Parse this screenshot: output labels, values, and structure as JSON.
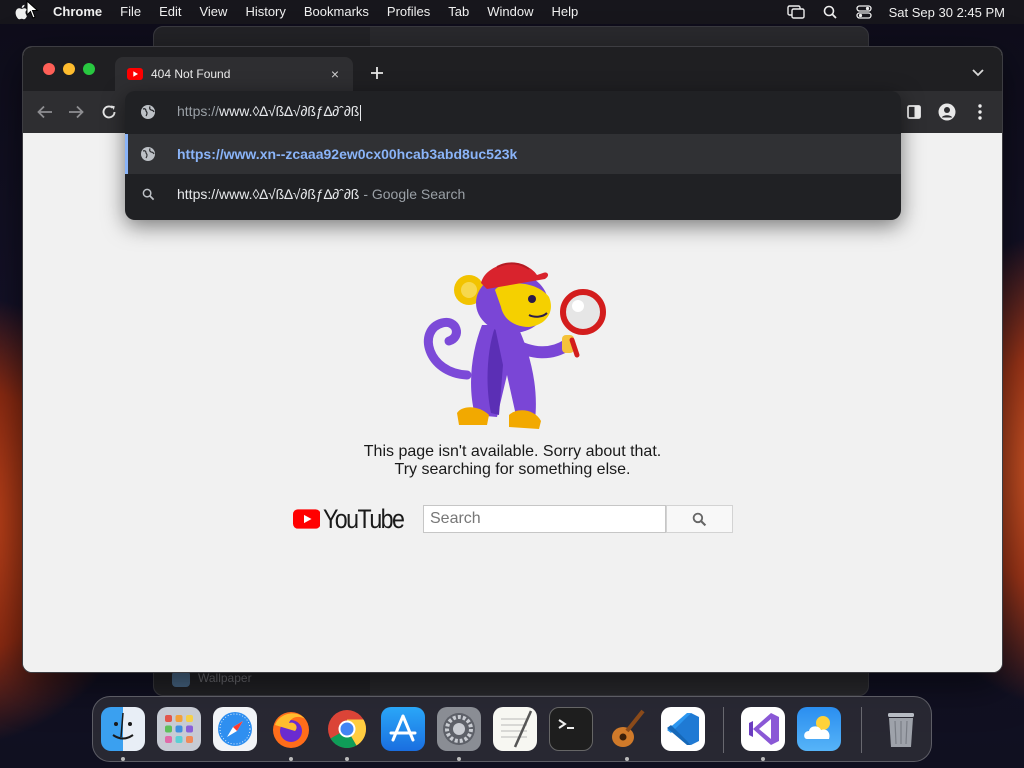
{
  "menubar": {
    "app_name": "Chrome",
    "items": [
      "File",
      "Edit",
      "View",
      "History",
      "Bookmarks",
      "Profiles",
      "Tab",
      "Window",
      "Help"
    ],
    "clock": "Sat Sep 30  2:45 PM"
  },
  "background_window": {
    "label": "Wallpaper"
  },
  "browser": {
    "tab": {
      "title": "404 Not Found",
      "close": "×"
    },
    "omnibox": {
      "scheme": "https://",
      "rest": "www.◊∆√ß∆√∂ßƒ∆∂ˆ∂ß",
      "suggestions": [
        {
          "icon": "globe-icon",
          "text": "https://www.xn--zcaaa92ew0cx00hcab3abd8uc523k",
          "sub": ""
        },
        {
          "icon": "search-icon",
          "text": "https://www.◊∆√ß∆√∂ßƒ∆∂ˆ∂ß",
          "sub": "- Google Search"
        }
      ]
    }
  },
  "page": {
    "message_line1": "This page isn't available. Sorry about that.",
    "message_line2": "Try searching for something else.",
    "logo_text": "YouTube",
    "search_placeholder": "Search"
  },
  "dock": {
    "apps": [
      "finder",
      "launchpad",
      "safari",
      "firefox",
      "chrome",
      "app-store",
      "system-settings",
      "textedit",
      "terminal",
      "garageband",
      "vscode",
      "visual-studio",
      "weather",
      "trash"
    ]
  },
  "colors": {
    "accent_link": "#8ab4f8",
    "youtube_red": "#ff0000",
    "titlebar": "#1f1f22",
    "toolbar": "#2e2e31",
    "omnibox_bg": "#202124"
  }
}
